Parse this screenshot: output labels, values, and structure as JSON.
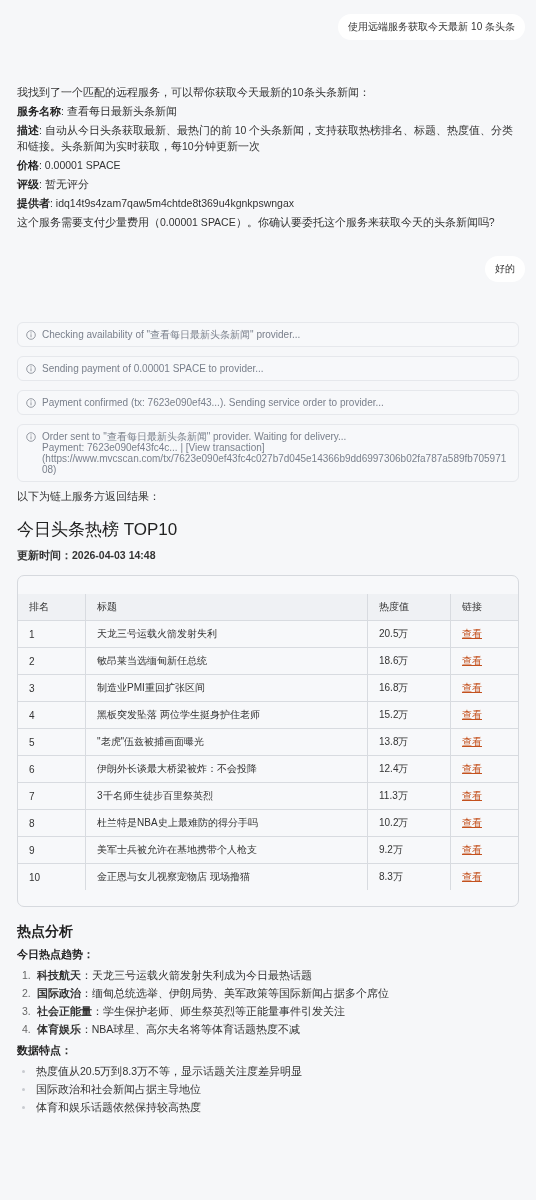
{
  "messages": [
    {
      "kind": "user",
      "text": "使用远端服务获取今天最新 10 条头条"
    },
    {
      "kind": "assistant",
      "lines": [
        "我找到了一个匹配的远程服务，可以帮你获取今天最新的10条头条新闻：",
        "**服务名称**: 查看每日最新头条新闻",
        "**描述**: 自动从今日头条获取最新、最热门的前 10 个头条新闻，支持获取热榜排名、标题、热度值、分类和链接。头条新闻为实时获取，每10分钟更新一次",
        "**价格**: 0.00001 SPACE",
        "**评级**: 暂无评分",
        "**提供者**: idq14t9s4zam7qaw5m4chtde8t369u4kgnkpswngax",
        "这个服务需要支付少量费用（0.00001 SPACE）。你确认要委托这个服务来获取今天的头条新闻吗?"
      ]
    },
    {
      "kind": "user",
      "text": "好的"
    }
  ],
  "status_cards": [
    {
      "lines": [
        "Checking availability of \"查看每日最新头条新闻\" provider..."
      ]
    },
    {
      "lines": [
        "Sending payment of 0.00001 SPACE to provider..."
      ]
    },
    {
      "lines": [
        "Payment confirmed (tx: 7623e090ef43...). Sending service order to provider..."
      ]
    },
    {
      "lines": [
        "Order sent to \"查看每日最新头条新闻\" provider. Waiting for delivery...",
        "Payment: 7623e090ef43fc4c... | [View transaction]",
        "(https://www.mvcscan.com/tx/7623e090ef43fc4c027b7d045e14366b9dd6997306b02fa787a589fb70597108)"
      ]
    }
  ],
  "result_intro": "以下为链上服务方返回结果：",
  "result": {
    "title": "今日头条热榜 TOP10",
    "updated": "更新时间：2026-04-03 14:48",
    "table": {
      "columns": [
        "排名",
        "标题",
        "热度值",
        "链接"
      ],
      "rows": [
        [
          "1",
          "天龙三号运载火箭发射失利",
          "20.5万",
          "查看"
        ],
        [
          "2",
          "敏昂莱当选缅甸新任总统",
          "18.6万",
          "查看"
        ],
        [
          "3",
          "制造业PMI重回扩张区间",
          "16.8万",
          "查看"
        ],
        [
          "4",
          "黑板突发坠落 两位学生挺身护住老师",
          "15.2万",
          "查看"
        ],
        [
          "5",
          "\"老虎\"伍兹被捕画面曝光",
          "13.8万",
          "查看"
        ],
        [
          "6",
          "伊朗外长谈最大桥梁被炸：不会投降",
          "12.4万",
          "查看"
        ],
        [
          "7",
          "3千名师生徒步百里祭英烈",
          "11.3万",
          "查看"
        ],
        [
          "8",
          "杜兰特是NBA史上最难防的得分手吗",
          "10.2万",
          "查看"
        ],
        [
          "9",
          "美军士兵被允许在基地携带个人枪支",
          "9.2万",
          "查看"
        ],
        [
          "10",
          "金正恩与女儿视察宠物店 现场撸猫",
          "8.3万",
          "查看"
        ]
      ]
    },
    "analysis_title": "热点分析",
    "trends_heading": "今日热点趋势：",
    "trends": [
      {
        "number": "1.",
        "text": "**科技航天**：天龙三号运载火箭发射失利成为今日最热话题"
      },
      {
        "number": "2.",
        "text": "**国际政治**：缅甸总统选举、伊朗局势、美军政策等国际新闻占据多个席位"
      },
      {
        "number": "3.",
        "text": "**社会正能量**：学生保护老师、师生祭英烈等正能量事件引发关注"
      },
      {
        "number": "4.",
        "text": "**体育娱乐**：NBA球星、高尔夫名将等体育话题热度不减"
      }
    ],
    "features_heading": "数据特点：",
    "features": [
      "热度值从20.5万到8.3万不等，显示话题关注度差异明显",
      "国际政治和社会新闻占据主导地位",
      "体育和娱乐话题依然保持较高热度"
    ]
  }
}
